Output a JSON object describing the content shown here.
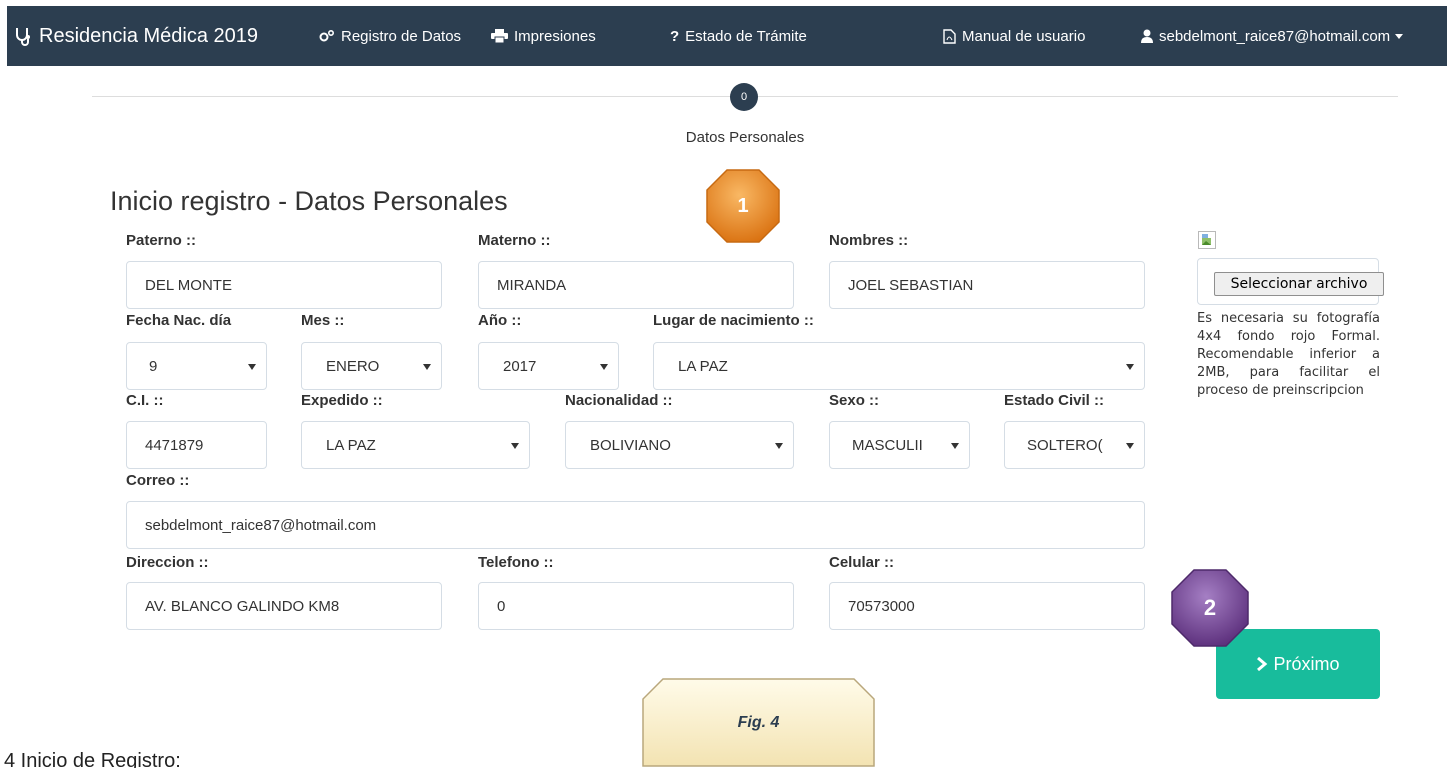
{
  "navbar": {
    "brand": "Residencia Médica 2019",
    "brand_icon": "stethoscope-icon",
    "links": [
      {
        "label": "Registro de Datos",
        "icon": "cogs-icon"
      },
      {
        "label": "Impresiones",
        "icon": "print-icon"
      },
      {
        "label": "Estado de Trámite",
        "icon": "question-icon"
      },
      {
        "label": "Manual de usuario",
        "icon": "pdf-file-icon"
      },
      {
        "label": "sebdelmont_raice87@hotmail.com",
        "icon": "user-icon"
      }
    ]
  },
  "stepper": {
    "number": "0",
    "label": "Datos Personales"
  },
  "page_title": "Inicio registro - Datos Personales",
  "form": {
    "paterno": {
      "label": "Paterno ::",
      "value": "DEL MONTE"
    },
    "materno": {
      "label": "Materno ::",
      "value": "MIRANDA"
    },
    "nombres": {
      "label": "Nombres ::",
      "value": "JOEL SEBASTIAN"
    },
    "dia": {
      "label": "Fecha Nac. día",
      "value": "9"
    },
    "mes": {
      "label": "Mes ::",
      "value": "ENERO"
    },
    "anio": {
      "label": "Año ::",
      "value": "2017"
    },
    "lugar": {
      "label": "Lugar de nacimiento ::",
      "value": "LA PAZ"
    },
    "ci": {
      "label": "C.I. ::",
      "value": "4471879"
    },
    "expedido": {
      "label": "Expedido ::",
      "value": "LA PAZ"
    },
    "nacionalidad": {
      "label": "Nacionalidad ::",
      "value": "BOLIVIANO"
    },
    "sexo": {
      "label": "Sexo ::",
      "value": "MASCULII"
    },
    "estado_civil": {
      "label": "Estado Civil ::",
      "value": "SOLTERO("
    },
    "correo": {
      "label": "Correo ::",
      "value": "sebdelmont_raice87@hotmail.com"
    },
    "direccion": {
      "label": "Direccion ::",
      "value": "AV. BLANCO GALINDO KM8"
    },
    "telefono": {
      "label": "Telefono ::",
      "value": "0"
    },
    "celular": {
      "label": "Celular ::",
      "value": "70573000"
    }
  },
  "photo": {
    "button_label": "Seleccionar archivo",
    "note": "Es necesaria su fotografía 4x4 fondo rojo Formal. Recomendable inferior a 2MB, para facilitar el proceso de preinscripcion"
  },
  "next_button": {
    "label": "Próximo",
    "icon": "chevron-right-icon"
  },
  "doc": {
    "callout_1": "1",
    "callout_2": "2",
    "figure_caption": "Fig. 4",
    "section_heading": "4   Inicio de Registro:"
  },
  "colors": {
    "navbar": "#2c3e50",
    "accent": "#18bc9c",
    "callout_1": "#e8821e",
    "callout_2": "#6b3a8c",
    "figure_box": "#fff4d6"
  }
}
